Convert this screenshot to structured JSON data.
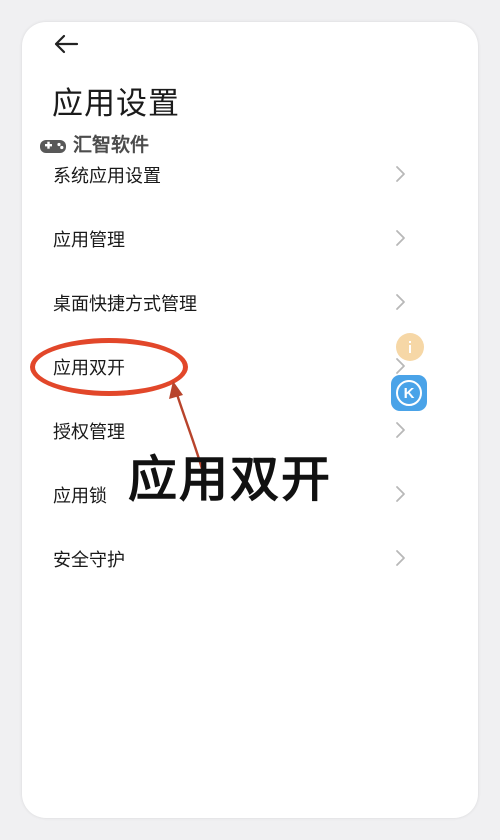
{
  "header": {
    "title": "应用设置"
  },
  "watermark": {
    "label": "汇智软件"
  },
  "menu": {
    "items": [
      {
        "label": "系统应用设置"
      },
      {
        "label": "应用管理"
      },
      {
        "label": "桌面快捷方式管理"
      },
      {
        "label": "应用双开"
      },
      {
        "label": "授权管理"
      },
      {
        "label": "应用锁"
      },
      {
        "label": "安全守护"
      }
    ]
  },
  "annotation": {
    "text": "应用双开",
    "color": "#e2472a"
  },
  "floating_widget": {
    "k_label": "K",
    "colors": {
      "dot": "#f6d7a6",
      "k_bg": "#4aa3e8"
    }
  },
  "icons": [
    "back-arrow-icon",
    "gamepad-icon",
    "chevron-right-icon",
    "k-app-icon"
  ]
}
